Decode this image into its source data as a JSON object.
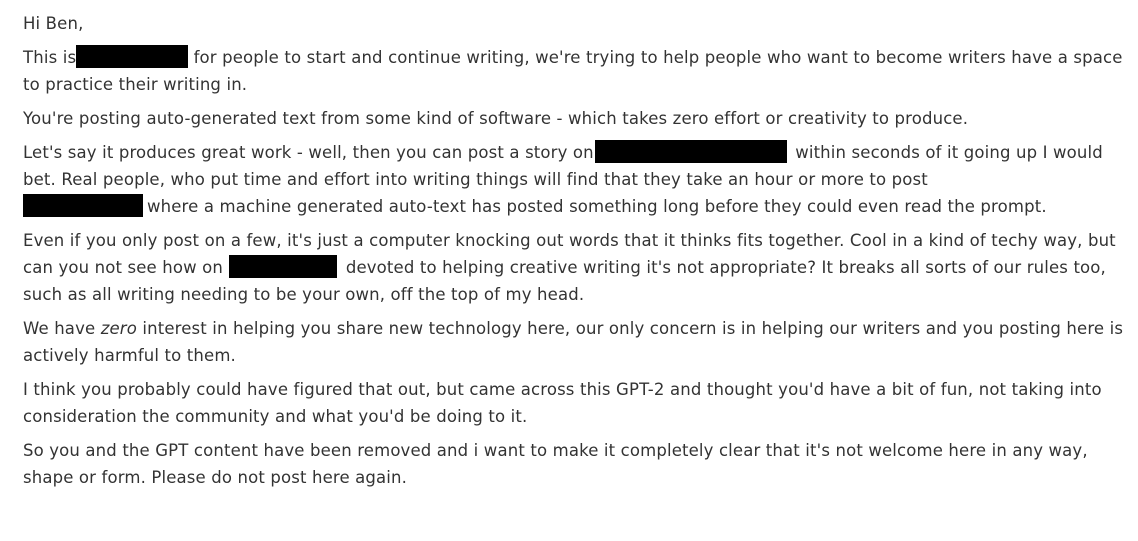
{
  "message": {
    "greeting": "Hi Ben,",
    "p1": {
      "before_redaction": "This is",
      "after_redaction": " for people to start and continue writing, we're trying to help people who want to become writers have a space to practice their writing in."
    },
    "p2": "You're posting auto-generated text from some kind of software - which takes zero effort or creativity to produce.",
    "p3": {
      "before_redaction_1": "Let's say it produces great work - well, then you can post a story on",
      "middle": "within seconds of it going up I would bet. Real people, who put time and effort into writing things will find that they take an hour or more to post",
      "after_redaction_2": "where a machine generated auto-text has posted something long before they could even read the prompt."
    },
    "p4": {
      "before_redaction": "Even if you only post on a few, it's just a computer knocking out words that it thinks fits together. Cool in a kind of techy way, but can you not see how on",
      "after_redaction": "devoted to helping creative writing it's not appropriate? It breaks all sorts of our rules too, such as all writing needing to be your own, off the top of my head."
    },
    "p5": {
      "before_emphasis": "We have ",
      "emphasis": "zero",
      "after_emphasis": " interest in helping you share new technology here, our only concern is in helping our writers and you posting here is actively harmful to them."
    },
    "p6": "I think you probably could have figured that out, but came across this GPT-2 and thought you'd have a bit of fun, not taking into consideration the community and what you'd be doing to it.",
    "p7": "So you and the GPT content have been removed and i want to make it completely clear that it's not welcome here in any way, shape or form. Please do not post here again."
  }
}
